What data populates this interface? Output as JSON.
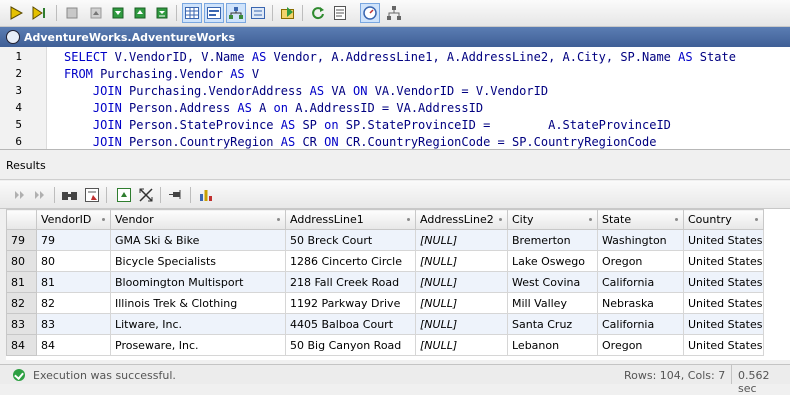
{
  "toolbar": {
    "buttons": [
      "execute-icon",
      "execute-step-icon",
      "stop-icon",
      "move-up-icon",
      "move-down-icon",
      "results-grid-icon",
      "results-text-icon",
      "results-tree-icon",
      "results-xml-icon",
      "export-icon",
      "refresh-icon",
      "script-icon",
      "history-icon",
      "plan-icon"
    ]
  },
  "document": {
    "title": "AdventureWorks.AdventureWorks"
  },
  "editor": {
    "lines": [
      {
        "n": "1",
        "code": "SELECT V.VendorID, V.Name AS Vendor, A.AddressLine1, A.AddressLine2, A.City, SP.Name AS State"
      },
      {
        "n": "2",
        "code": "FROM Purchasing.Vendor AS V"
      },
      {
        "n": "3",
        "code": "    JOIN Purchasing.VendorAddress AS VA ON VA.VendorID = V.VendorID"
      },
      {
        "n": "4",
        "code": "    JOIN Person.Address AS A on A.AddressID = VA.AddressID"
      },
      {
        "n": "5",
        "code": "    JOIN Person.StateProvince AS SP on SP.StateProvinceID =        A.StateProvinceID"
      },
      {
        "n": "6",
        "code": "    JOIN Person.CountryRegion AS CR ON CR.CountryRegionCode = SP.CountryRegionCode"
      }
    ]
  },
  "results": {
    "label": "Results",
    "columns": [
      "VendorID",
      "Vendor",
      "AddressLine1",
      "AddressLine2",
      "City",
      "State",
      "Country"
    ],
    "rows": [
      {
        "n": "79",
        "cells": [
          "79",
          "GMA Ski & Bike",
          "50 Breck Court",
          "[NULL]",
          "Bremerton",
          "Washington",
          "United States"
        ]
      },
      {
        "n": "80",
        "cells": [
          "80",
          "Bicycle Specialists",
          "1286 Cincerto Circle",
          "[NULL]",
          "Lake Oswego",
          "Oregon",
          "United States"
        ]
      },
      {
        "n": "81",
        "cells": [
          "81",
          "Bloomington Multisport",
          "218 Fall Creek Road",
          "[NULL]",
          "West Covina",
          "California",
          "United States"
        ]
      },
      {
        "n": "82",
        "cells": [
          "82",
          "Illinois Trek & Clothing",
          "1192 Parkway Drive",
          "[NULL]",
          "Mill Valley",
          "Nebraska",
          "United States"
        ]
      },
      {
        "n": "83",
        "cells": [
          "83",
          "Litware, Inc.",
          "4405 Balboa Court",
          "[NULL]",
          "Santa Cruz",
          "California",
          "United States"
        ]
      },
      {
        "n": "84",
        "cells": [
          "84",
          "Proseware, Inc.",
          "50 Big Canyon Road",
          "[NULL]",
          "Lebanon",
          "Oregon",
          "United States"
        ]
      }
    ]
  },
  "status": {
    "message": "Execution was successful.",
    "rows_cols": "Rows: 104, Cols: 7",
    "time": "0.562 sec"
  }
}
